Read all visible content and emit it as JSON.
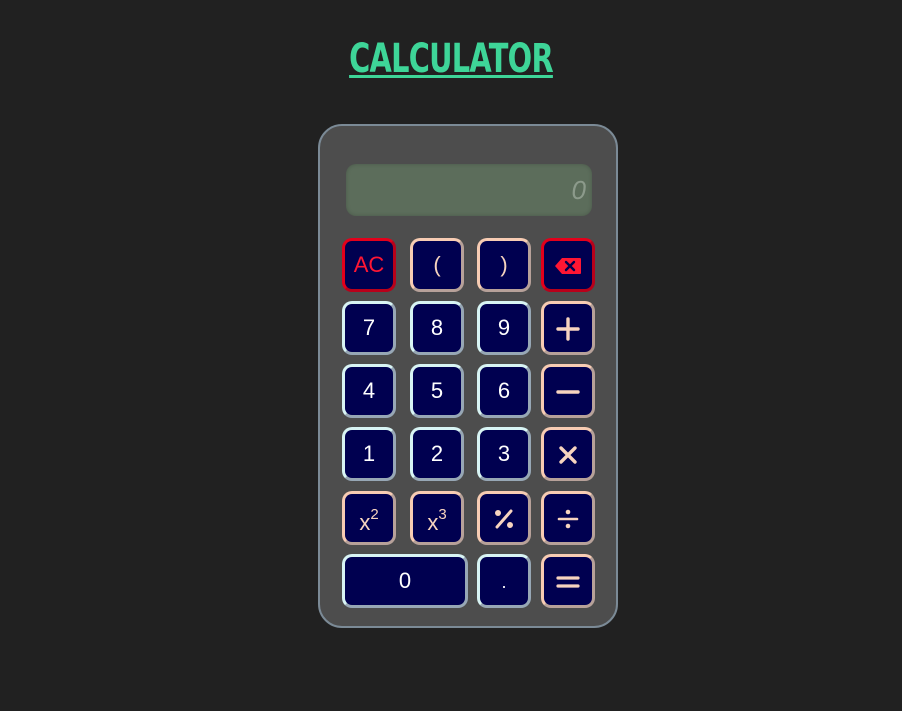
{
  "title": "Calculator",
  "display": {
    "value": "0"
  },
  "keys": {
    "ac": "AC",
    "open_paren": "(",
    "close_paren": ")",
    "seven": "7",
    "eight": "8",
    "nine": "9",
    "four": "4",
    "five": "5",
    "six": "6",
    "one": "1",
    "two": "2",
    "three": "3",
    "square_base": "x",
    "square_exp": "2",
    "cube_base": "x",
    "cube_exp": "3",
    "zero": "0",
    "decimal": "."
  },
  "icons": {
    "backspace": "backspace-icon",
    "add": "plus-icon",
    "subtract": "minus-icon",
    "multiply": "times-icon",
    "divide": "divide-icon",
    "percent": "percent-icon",
    "equals": "equals-icon"
  },
  "colors": {
    "background": "#212121",
    "title": "#3ed598",
    "body": "#4d4d4d",
    "display": "#5c6d5b",
    "key_fill": "#000050",
    "number_border": "#d8f4f4",
    "operator_border": "#f7ccb3",
    "clear_border": "#e3001b"
  }
}
